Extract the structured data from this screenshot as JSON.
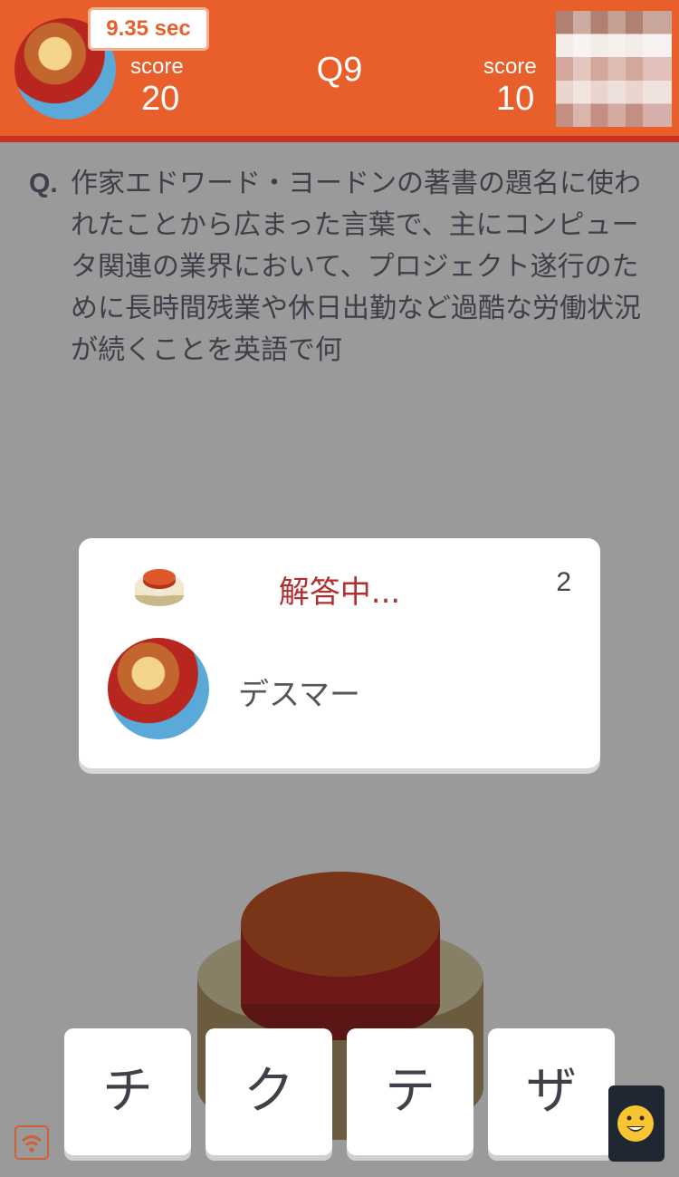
{
  "header": {
    "timer": "9.35 sec",
    "question_number": "Q9",
    "player_left": {
      "score_label": "score",
      "score": "20"
    },
    "player_right": {
      "score_label": "score",
      "score": "10"
    }
  },
  "question": {
    "prefix": "Q.",
    "text": "作家エドワード・ヨードンの著書の題名に使われたことから広まった言葉で、主にコンピュータ関連の業界において、プロジェクト遂行のために長時間残業や休日出勤など過酷な労働状況が続くことを英語で何"
  },
  "answer_card": {
    "status": "解答中...",
    "count": "2",
    "player_name": "デスマー"
  },
  "choices": [
    "チ",
    "ク",
    "テ",
    "ザ"
  ],
  "icons": {
    "buzzer": "buzzer-icon",
    "wifi": "wifi-icon",
    "emoji": "emoji-smile-icon"
  },
  "colors": {
    "header": "#e85f2c",
    "accent_red": "#c9301f",
    "status_text": "#b03030",
    "background": "#9a9a9a"
  }
}
